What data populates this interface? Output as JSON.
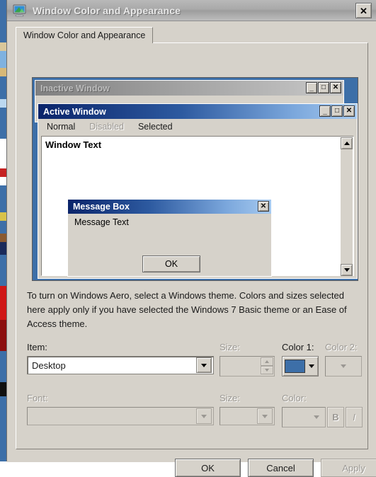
{
  "window": {
    "title": "Window Color and Appearance",
    "icon": "display-monitor-icon",
    "close_label": "✕"
  },
  "tab": {
    "label": "Window Color and Appearance"
  },
  "preview": {
    "background_color": "#3d6fa8",
    "inactive_window": {
      "title": "Inactive Window",
      "minimize_label": "_",
      "maximize_label": "□",
      "close_label": "✕"
    },
    "active_window": {
      "title": "Active Window",
      "minimize_label": "_",
      "maximize_label": "□",
      "close_label": "✕",
      "menu": [
        {
          "label": "Normal",
          "state": "normal"
        },
        {
          "label": "Disabled",
          "state": "disabled"
        },
        {
          "label": "Selected",
          "state": "selected"
        }
      ],
      "client_text": "Window Text"
    },
    "message_box": {
      "title": "Message Box",
      "close_label": "✕",
      "body_text": "Message Text",
      "ok_label": "OK"
    }
  },
  "description": "To turn on Windows Aero, select a Windows theme.  Colors and sizes selected here apply only if you have selected the Windows 7 Basic theme or an Ease of Access theme.",
  "item_row": {
    "item_label": "Item:",
    "item_value": "Desktop",
    "size_label": "Size:",
    "size_value": "",
    "color1_label": "Color 1:",
    "color1_value": "#3d6fa8",
    "color2_label": "Color 2:"
  },
  "font_row": {
    "font_label": "Font:",
    "font_value": "",
    "size_label": "Size:",
    "size_value": "",
    "color_label": "Color:",
    "bold_label": "B",
    "italic_label": "I"
  },
  "buttons": {
    "ok": "OK",
    "cancel": "Cancel",
    "apply": "Apply"
  }
}
